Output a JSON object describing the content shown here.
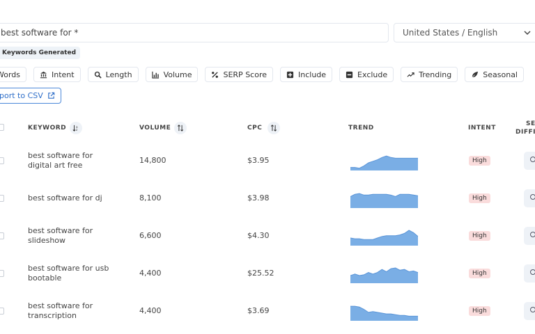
{
  "search": {
    "value": "best software for *"
  },
  "locale": {
    "value": "United States / English"
  },
  "badge": {
    "label": "Keywords Generated"
  },
  "filters": [
    {
      "label": "Words",
      "icon": "none"
    },
    {
      "label": "Intent",
      "icon": "bank-icon"
    },
    {
      "label": "Length",
      "icon": "search-icon"
    },
    {
      "label": "Volume",
      "icon": "bar-chart-icon"
    },
    {
      "label": "SERP Score",
      "icon": "percent-icon"
    },
    {
      "label": "Include",
      "icon": "plus-square-icon"
    },
    {
      "label": "Exclude",
      "icon": "minus-square-icon"
    },
    {
      "label": "Trending",
      "icon": "trend-icon"
    },
    {
      "label": "Seasonal",
      "icon": "leaf-icon"
    }
  ],
  "export": {
    "label": "port to CSV"
  },
  "table": {
    "headers": {
      "keyword": "KEYWORD",
      "volume": "VOLUME",
      "cpc": "CPC",
      "trend": "TREND",
      "intent": "INTENT",
      "serp": "SE",
      "serp2": "DIFFIC"
    },
    "rows": [
      {
        "line1": "best software for",
        "line2": "digital art free",
        "volume": "14,800",
        "cpc": "$3.95",
        "intent": "High",
        "trend": [
          0.2,
          0.2,
          0.15,
          0.3,
          0.5,
          0.6,
          0.7,
          0.85,
          0.95,
          0.85,
          0.8,
          0.8,
          0.8,
          0.8,
          0.8,
          0.8
        ]
      },
      {
        "line1": "best software for dj",
        "line2": "",
        "volume": "8,100",
        "cpc": "$3.98",
        "intent": "High",
        "trend": [
          0.75,
          0.9,
          0.95,
          0.85,
          0.85,
          0.9,
          0.9,
          0.9,
          0.9,
          0.85,
          0.75,
          0.9,
          0.9,
          0.9,
          0.85,
          0.8
        ]
      },
      {
        "line1": "best software for",
        "line2": "slideshow",
        "volume": "6,600",
        "cpc": "$4.30",
        "intent": "High",
        "trend": [
          0.5,
          0.45,
          0.45,
          0.4,
          0.4,
          0.4,
          0.5,
          0.6,
          0.65,
          0.65,
          0.65,
          0.7,
          0.8,
          1.0,
          0.85,
          0.6
        ]
      },
      {
        "line1": "best software for usb",
        "line2": "bootable",
        "volume": "4,400",
        "cpc": "$25.52",
        "intent": "High",
        "trend": [
          0.5,
          0.6,
          0.5,
          0.55,
          0.7,
          0.6,
          0.7,
          0.9,
          0.75,
          0.95,
          1.0,
          0.85,
          0.9,
          0.75,
          0.8,
          0.7
        ]
      },
      {
        "line1": "best software for",
        "line2": "transcription",
        "volume": "4,400",
        "cpc": "$3.69",
        "intent": "High",
        "trend": [
          0.95,
          0.95,
          0.9,
          0.75,
          0.55,
          0.6,
          0.55,
          0.5,
          0.45,
          0.45,
          0.4,
          0.35,
          0.35,
          0.3,
          0.3,
          0.3
        ]
      }
    ]
  },
  "colors": {
    "trend_fill": "#7aaee5",
    "trend_stroke": "#5b95d8",
    "intent_bg": "#fadcdc",
    "accent": "#2f6fc9"
  }
}
